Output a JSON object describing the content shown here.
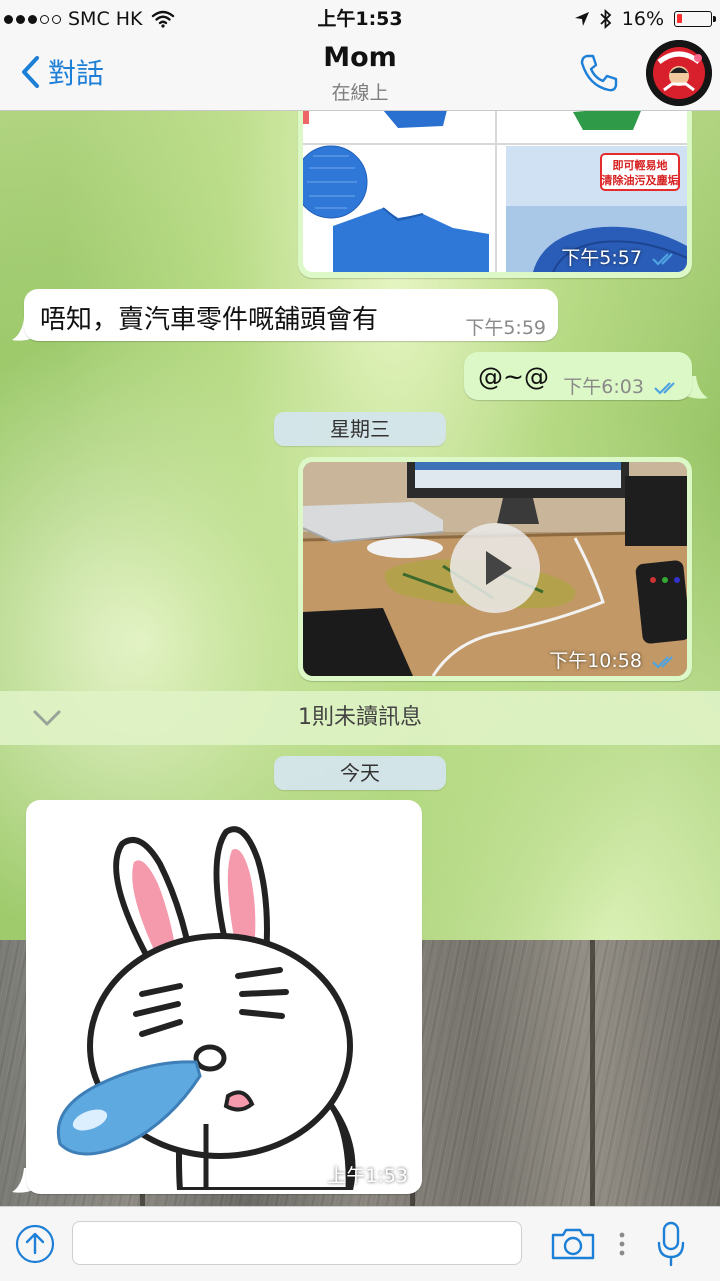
{
  "status_bar": {
    "carrier": "SMC HK",
    "time": "上午1:53",
    "battery": "16%",
    "battery_level": 0.16
  },
  "header": {
    "back_label": "對話",
    "title": "Mom",
    "subtitle": "在線上"
  },
  "messages": {
    "m1": {
      "direction": "outgoing",
      "type": "image",
      "time": "下午5:57",
      "overlay_text": "即可輕易地\n清除油污及塵垢"
    },
    "m2": {
      "direction": "incoming",
      "type": "text",
      "text": "唔知，賣汽車零件嘅舖頭會有",
      "time": "下午5:59"
    },
    "m3": {
      "direction": "outgoing",
      "type": "text",
      "text": "@~@",
      "time": "下午6:03"
    },
    "day1": "星期三",
    "m4": {
      "direction": "outgoing",
      "type": "video",
      "time": "下午10:58"
    },
    "unread": "1則未讀訊息",
    "day2": "今天",
    "m5": {
      "direction": "incoming",
      "type": "sticker",
      "time": "上午1:53"
    }
  },
  "input": {
    "placeholder": ""
  },
  "colors": {
    "accent": "#1e7fd7",
    "outgoing_bubble": "#dcf8c6",
    "incoming_bubble": "#ffffff",
    "read_ticks": "#4fa3e0"
  },
  "icons": [
    "signal-dots-icon",
    "wifi-icon",
    "location-arrow-icon",
    "bluetooth-icon",
    "battery-icon",
    "back-chevron-icon",
    "phone-icon",
    "play-icon",
    "chevron-down-icon",
    "upload-icon",
    "camera-icon",
    "microphone-icon"
  ]
}
